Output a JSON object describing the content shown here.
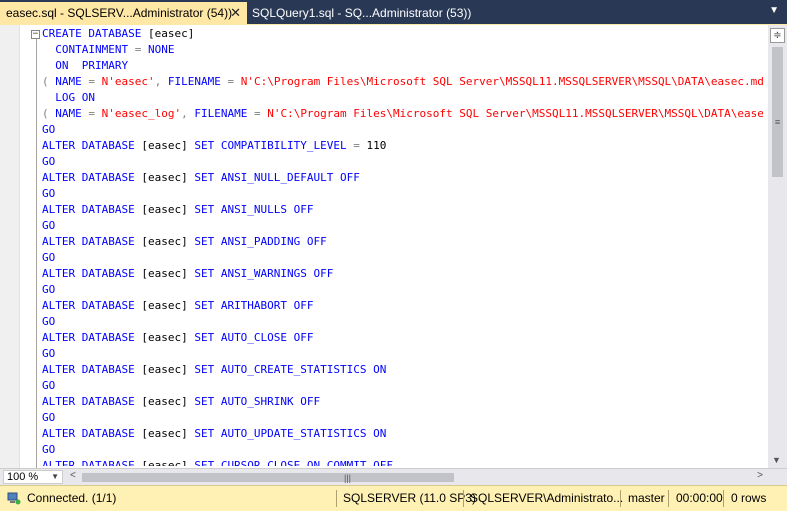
{
  "tabs": [
    {
      "label": "easec.sql - SQLSERV...Administrator (54))",
      "active": true,
      "close_label": "✕"
    },
    {
      "label": "SQLQuery1.sql - SQ...Administrator (53))",
      "active": false
    }
  ],
  "tab_dropdown_glyph": "▼",
  "editor": {
    "collapse_glyph": "−",
    "lines": [
      [
        {
          "t": "CREATE DATABASE",
          "c": "kw"
        },
        {
          "t": " [easec]",
          "c": "id"
        }
      ],
      [
        {
          "t": "  CONTAINMENT ",
          "c": "kw"
        },
        {
          "t": "=",
          "c": "op"
        },
        {
          "t": " NONE",
          "c": "kw"
        }
      ],
      [
        {
          "t": "  ON  PRIMARY",
          "c": "kw"
        }
      ],
      [
        {
          "t": "( ",
          "c": "op"
        },
        {
          "t": "NAME ",
          "c": "kw"
        },
        {
          "t": "=",
          "c": "op"
        },
        {
          "t": " N'easec'",
          "c": "str"
        },
        {
          "t": ", ",
          "c": "op"
        },
        {
          "t": "FILENAME ",
          "c": "kw"
        },
        {
          "t": "=",
          "c": "op"
        },
        {
          "t": " N'C:\\Program Files\\Microsoft SQL Server\\MSSQL11.MSSQLSERVER\\MSSQL\\DATA\\easec.mdf'",
          "c": "str"
        }
      ],
      [
        {
          "t": "  LOG ON",
          "c": "kw"
        }
      ],
      [
        {
          "t": "( ",
          "c": "op"
        },
        {
          "t": "NAME ",
          "c": "kw"
        },
        {
          "t": "=",
          "c": "op"
        },
        {
          "t": " N'easec_log'",
          "c": "str"
        },
        {
          "t": ", ",
          "c": "op"
        },
        {
          "t": "FILENAME ",
          "c": "kw"
        },
        {
          "t": "=",
          "c": "op"
        },
        {
          "t": " N'C:\\Program Files\\Microsoft SQL Server\\MSSQL11.MSSQLSERVER\\MSSQL\\DATA\\easec_log.ldf'",
          "c": "str"
        }
      ],
      [
        {
          "t": "GO",
          "c": "kw"
        }
      ],
      [
        {
          "t": "ALTER DATABASE",
          "c": "kw"
        },
        {
          "t": " [easec] ",
          "c": "id"
        },
        {
          "t": "SET COMPATIBILITY_LEVEL ",
          "c": "kw"
        },
        {
          "t": "=",
          "c": "op"
        },
        {
          "t": " 110",
          "c": "id"
        }
      ],
      [
        {
          "t": "GO",
          "c": "kw"
        }
      ],
      [
        {
          "t": "ALTER DATABASE",
          "c": "kw"
        },
        {
          "t": " [easec] ",
          "c": "id"
        },
        {
          "t": "SET ANSI_NULL_DEFAULT OFF",
          "c": "kw"
        }
      ],
      [
        {
          "t": "GO",
          "c": "kw"
        }
      ],
      [
        {
          "t": "ALTER DATABASE",
          "c": "kw"
        },
        {
          "t": " [easec] ",
          "c": "id"
        },
        {
          "t": "SET ANSI_NULLS OFF",
          "c": "kw"
        }
      ],
      [
        {
          "t": "GO",
          "c": "kw"
        }
      ],
      [
        {
          "t": "ALTER DATABASE",
          "c": "kw"
        },
        {
          "t": " [easec] ",
          "c": "id"
        },
        {
          "t": "SET ANSI_PADDING OFF",
          "c": "kw"
        }
      ],
      [
        {
          "t": "GO",
          "c": "kw"
        }
      ],
      [
        {
          "t": "ALTER DATABASE",
          "c": "kw"
        },
        {
          "t": " [easec] ",
          "c": "id"
        },
        {
          "t": "SET ANSI_WARNINGS OFF",
          "c": "kw"
        }
      ],
      [
        {
          "t": "GO",
          "c": "kw"
        }
      ],
      [
        {
          "t": "ALTER DATABASE",
          "c": "kw"
        },
        {
          "t": " [easec] ",
          "c": "id"
        },
        {
          "t": "SET ARITHABORT OFF",
          "c": "kw"
        }
      ],
      [
        {
          "t": "GO",
          "c": "kw"
        }
      ],
      [
        {
          "t": "ALTER DATABASE",
          "c": "kw"
        },
        {
          "t": " [easec] ",
          "c": "id"
        },
        {
          "t": "SET AUTO_CLOSE OFF",
          "c": "kw"
        }
      ],
      [
        {
          "t": "GO",
          "c": "kw"
        }
      ],
      [
        {
          "t": "ALTER DATABASE",
          "c": "kw"
        },
        {
          "t": " [easec] ",
          "c": "id"
        },
        {
          "t": "SET AUTO_CREATE_STATISTICS ON",
          "c": "kw"
        }
      ],
      [
        {
          "t": "GO",
          "c": "kw"
        }
      ],
      [
        {
          "t": "ALTER DATABASE",
          "c": "kw"
        },
        {
          "t": " [easec] ",
          "c": "id"
        },
        {
          "t": "SET AUTO_SHRINK OFF",
          "c": "kw"
        }
      ],
      [
        {
          "t": "GO",
          "c": "kw"
        }
      ],
      [
        {
          "t": "ALTER DATABASE",
          "c": "kw"
        },
        {
          "t": " [easec] ",
          "c": "id"
        },
        {
          "t": "SET AUTO_UPDATE_STATISTICS ON",
          "c": "kw"
        }
      ],
      [
        {
          "t": "GO",
          "c": "kw"
        }
      ],
      [
        {
          "t": "ALTER DATABASE",
          "c": "kw"
        },
        {
          "t": " [easec] ",
          "c": "id"
        },
        {
          "t": "SET CURSOR_CLOSE_ON_COMMIT OFF",
          "c": "kw"
        }
      ]
    ]
  },
  "scrollbar": {
    "split_glyph": "≑",
    "grip_glyph": "≡",
    "down_glyph": "▼",
    "left_glyph": "<",
    "right_glyph": ">",
    "hgrip_glyph": "|||"
  },
  "zoom": {
    "value": "100 %",
    "arrow": "▼"
  },
  "status": {
    "connection": "Connected. (1/1)",
    "server": "SQLSERVER (11.0 SP3)",
    "user": "SQLSERVER\\Administrato...",
    "database": "master",
    "elapsed": "00:00:00",
    "rows": "0 rows"
  },
  "colors": {
    "keyword": "#0000ff",
    "string": "#ff0000",
    "operator": "#808080",
    "status_bg": "#fff0b3",
    "tab_active": "#ffe8a6",
    "tabstrip": "#293955"
  }
}
